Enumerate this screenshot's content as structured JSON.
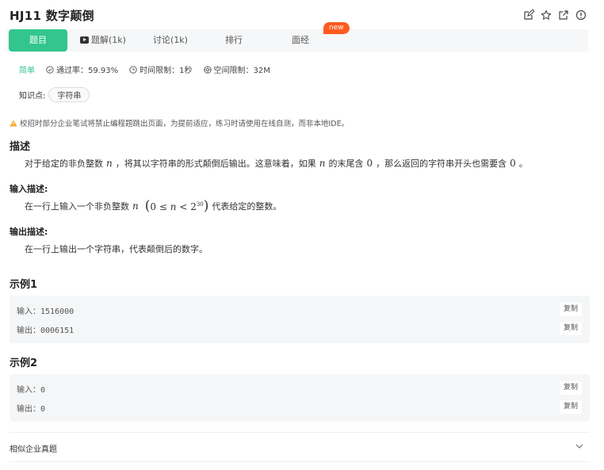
{
  "header": {
    "title": "HJ11  数字颠倒",
    "icons": [
      "edit-icon",
      "star-icon",
      "share-icon",
      "info-icon"
    ]
  },
  "tabs": [
    {
      "label": "题目",
      "active": true
    },
    {
      "label": "题解(1k)"
    },
    {
      "label": "讨论(1k)"
    },
    {
      "label": "排行"
    },
    {
      "label": "面经"
    }
  ],
  "tab_badge": "new",
  "meta": {
    "difficulty": "简单",
    "pass_rate": "通过率：59.93%",
    "time_limit": "时间限制：1秒",
    "space_limit": "空间限制：32M"
  },
  "knowledge": {
    "label": "知识点:",
    "tag": "字符串"
  },
  "warning": "校招时部分企业笔试将禁止编程题跳出页面，为提前适应，练习时请使用在线自测，而非本地IDE。",
  "description": {
    "heading": "描述",
    "text_1": "对于给定的非负整数",
    "var_n": "n",
    "text_2": "，将其以字符串的形式颠倒后输出。这意味着，如果",
    "text_3": "的末尾含",
    "zero": "0",
    "text_4": "，那么返回的字符串开头也需要含",
    "text_5": "。"
  },
  "input_desc": {
    "heading": "输入描述:",
    "text_1": "在一行上输入一个非负整数",
    "paren_open": "(",
    "zero": "0",
    "le": "≤",
    "var_n": "n",
    "lt": "<",
    "base": "2",
    "exp": "30",
    "paren_close": ")",
    "text_2": "代表给定的整数。"
  },
  "output_desc": {
    "heading": "输出描述:",
    "text": "在一行上输出一个字符串，代表颠倒后的数字。"
  },
  "examples": [
    {
      "heading": "示例1",
      "input_label": "输入：",
      "input": "1516000",
      "output_label": "输出：",
      "output": "0006151",
      "copy": "复制"
    },
    {
      "heading": "示例2",
      "input_label": "输入：",
      "input": "0",
      "output_label": "输出：",
      "output": "0",
      "copy": "复制"
    }
  ],
  "similar": {
    "label": "相似企业真题"
  },
  "colors": {
    "accent": "#32c68d",
    "badge": "#ff5a1f",
    "warning": "#f5a623"
  }
}
